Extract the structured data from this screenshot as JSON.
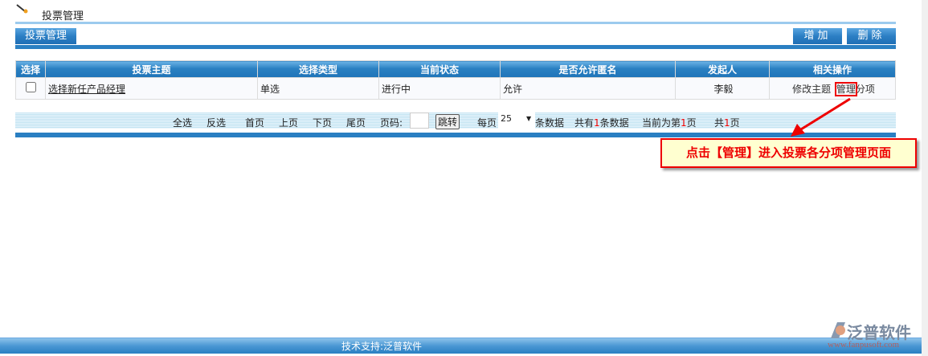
{
  "header": {
    "title": "投票管理",
    "icon": "pencil-icon"
  },
  "tab": {
    "label": "投票管理"
  },
  "toolbar": {
    "add_label": "增加",
    "delete_label": "删除"
  },
  "table": {
    "columns": [
      "选择",
      "投票主题",
      "选择类型",
      "当前状态",
      "是否允许匿名",
      "发起人",
      "相关操作"
    ],
    "rows": [
      {
        "subject": "选择新任产品经理",
        "type": "单选",
        "status": "进行中",
        "anonymous": "允许",
        "initiator": "李毅",
        "op_edit": "修改主题",
        "op_manage": "管理",
        "op_suffix": "分项"
      }
    ]
  },
  "pager": {
    "select_all": "全选",
    "invert": "反选",
    "first": "首页",
    "prev": "上页",
    "next": "下页",
    "last": "尾页",
    "page_label": "页码:",
    "page_value": "",
    "jump": "跳转",
    "per_page_label": "每页",
    "per_page": "25",
    "per_page_suffix": "条数据",
    "total_prefix": "共有",
    "total": "1",
    "total_suffix": "条数据",
    "current_prefix": "当前为第",
    "current": "1",
    "current_suffix": "页",
    "pages_prefix": "共",
    "pages": "1",
    "pages_suffix": "页"
  },
  "annotation": {
    "text": "点击【管理】进入投票各分项管理页面",
    "color": "#e00000"
  },
  "footer": {
    "text": "技术支持:泛普软件"
  },
  "logo": {
    "name": "泛普软件",
    "url": "www.fanpusoft.com"
  }
}
